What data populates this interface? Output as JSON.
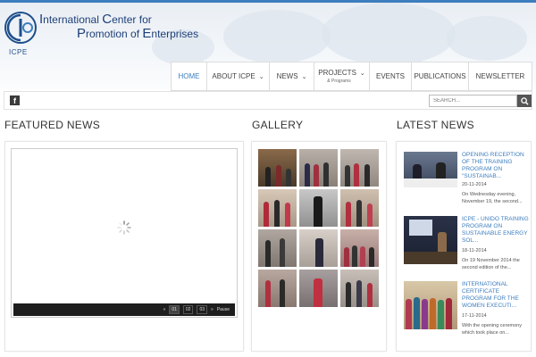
{
  "header": {
    "logo_label": "ICPE",
    "org_name_lines": [
      {
        "cap": "I",
        "rest": "nternational ",
        "cap2": "C",
        "rest2": "enter for"
      },
      {
        "cap": "P",
        "rest": "romotion of ",
        "cap2": "E",
        "rest2": "nterprises"
      }
    ]
  },
  "nav": {
    "items": [
      {
        "label": "HOME",
        "active": true,
        "dropdown": false,
        "sub": ""
      },
      {
        "label": "ABOUT ICPE",
        "active": false,
        "dropdown": true,
        "sub": ""
      },
      {
        "label": "NEWS",
        "active": false,
        "dropdown": true,
        "sub": ""
      },
      {
        "label": "PROJECTS",
        "active": false,
        "dropdown": true,
        "sub": "& Programs"
      },
      {
        "label": "EVENTS",
        "active": false,
        "dropdown": false,
        "sub": ""
      },
      {
        "label": "PUBLICATIONS",
        "active": false,
        "dropdown": false,
        "sub": ""
      },
      {
        "label": "NEWSLETTER",
        "active": false,
        "dropdown": false,
        "sub": ""
      }
    ]
  },
  "toolbar": {
    "social_icon": "facebook-icon",
    "search_placeholder": "SEARCH..."
  },
  "sections": {
    "featured": "FEATURED NEWS",
    "gallery": "GALLERY",
    "latest": "LATEST NEWS"
  },
  "slider": {
    "pages": [
      "01",
      "02",
      "03"
    ],
    "current_page": "01",
    "prev": "«",
    "next": "»",
    "pause_label": "Pause"
  },
  "gallery": {
    "thumb_count": 12
  },
  "latest_news": [
    {
      "title": "OPENING RECEPTION OF THE TRAINING PROGRAM ON \"SUSTAINAB...",
      "date": "20-11-2014",
      "excerpt": "On Wednesday evening, November 19, the second..."
    },
    {
      "title": "ICPE - UNIDO TRAINING PROGRAM ON SUSTAINABLE ENERGY SOL...",
      "date": "18-11-2014",
      "excerpt": "On 19 November 2014 the second edition of the..."
    },
    {
      "title": "INTERNATIONAL CERTIFICATE PROGRAM FOR THE WOMEN EXECUTI...",
      "date": "17-11-2014",
      "excerpt": "With the opening ceremony which took place on..."
    }
  ],
  "colors": {
    "accent": "#3d7ebf",
    "brand_dark": "#1e3f78"
  }
}
